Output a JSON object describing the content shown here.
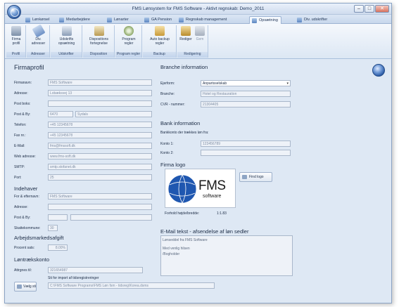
{
  "window": {
    "title": "FMS Lønsystem for FMS Software - Aktivt regnskab: Demo_2011",
    "controls": [
      "–",
      "□",
      "✕"
    ]
  },
  "tabs": [
    {
      "label": "Lønkørsel",
      "active": false
    },
    {
      "label": "Medarbejdere",
      "active": false
    },
    {
      "label": "Lønarter",
      "active": false
    },
    {
      "label": "GA Pension",
      "active": false
    },
    {
      "label": "Regnskab management",
      "active": false
    },
    {
      "label": "Opsætning",
      "active": true
    },
    {
      "label": "Div. udskrifter",
      "active": false
    }
  ],
  "ribbon": {
    "groups": [
      {
        "label": "Profil",
        "buttons": [
          {
            "label1": "Firma",
            "label2": "profil"
          }
        ]
      },
      {
        "label": "Adresser",
        "buttons": [
          {
            "label1": "Div.",
            "label2": "adresser"
          }
        ]
      },
      {
        "label": "Udskrifter",
        "buttons": [
          {
            "label1": "Udskrifts",
            "label2": "opsætning"
          }
        ]
      },
      {
        "label": "Disposition",
        "buttons": [
          {
            "label1": "Dispositions",
            "label2": "fortegnelse"
          }
        ]
      },
      {
        "label": "Program regler",
        "buttons": [
          {
            "label1": "Program",
            "label2": "regler"
          }
        ]
      },
      {
        "label": "Backup",
        "buttons": [
          {
            "label1": "Auto backup",
            "label2": "regler"
          }
        ]
      },
      {
        "label": "Redigering",
        "buttons": [
          {
            "label1": "Rediger",
            "label2": ""
          },
          {
            "label1": "Gem",
            "label2": ""
          }
        ]
      }
    ]
  },
  "firmaprofil": {
    "heading": "Firmaprofil",
    "fields": [
      {
        "label": "Firmanavn:",
        "value": "FMS Software"
      },
      {
        "label": "Adresse:",
        "value": "Lobæksvej 13"
      },
      {
        "label": "Post boks:",
        "value": ""
      },
      {
        "label": "Post & By:",
        "value": "6470",
        "value2": "Sydals"
      },
      {
        "label": "Telefon:",
        "value": "+45 12345678"
      },
      {
        "label": "Fax nr.:",
        "value": "+45 12345678"
      },
      {
        "label": "E-Mail:",
        "value": "fms@fmssoft.dk"
      },
      {
        "label": "Web adresse:",
        "value": "www.fms-soft.dk"
      },
      {
        "label": "SMTP:",
        "value": "smtp.stofanet.dk"
      },
      {
        "label": "Port:",
        "value": "25"
      }
    ]
  },
  "indehaver": {
    "heading": "Indehaver",
    "fields": [
      {
        "label": "For & efternavn:",
        "value": "FMS Software"
      },
      {
        "label": "Adresse:",
        "value": ""
      },
      {
        "label": "Post & By:",
        "value": "",
        "value2": ""
      },
      {
        "label": "Skattekommune:",
        "value": "30"
      }
    ]
  },
  "arbejdsmarked": {
    "heading": "Arbejdsmarkedsafgift",
    "label": "Procent sats:",
    "value": "8.00%"
  },
  "loentraek": {
    "heading": "Løntrækskonto",
    "label": "Attrgnes til:",
    "value": "321654987",
    "import_label": "Sti for import af tidsregistreringer",
    "import_button": "Vælg sti",
    "import_path": "C:\\FMS Software Programs\\FMS Løn fsm - tidsreg\\Korea.dsms"
  },
  "branche": {
    "heading": "Branche information",
    "fields": [
      {
        "label": "Ejerform:",
        "value": "Anpartsselskab",
        "type": "select"
      },
      {
        "label": "Branche:",
        "value": "Hotel og Restauration"
      },
      {
        "label": "CVR - nummer:",
        "value": "21304405"
      }
    ]
  },
  "bank": {
    "heading": "Bank information",
    "subtitle": "Bankkonto der trækkes løn fra:",
    "fields": [
      {
        "label": "Konto 1:",
        "value": "123456789"
      },
      {
        "label": "Konto 2:",
        "value": ""
      }
    ]
  },
  "logo": {
    "heading": "Firma logo",
    "brand": "FMS",
    "brand_sub": "software",
    "find_button": "Find logo",
    "ratio_label": "Forhold højde/bredde:",
    "ratio_value": "1:1.83"
  },
  "email": {
    "heading": "E-Mail tekst - afsendelse af løn sedler",
    "lines": [
      "Lønseddel fra FMS Software",
      "",
      "Med venlig hilsen",
      "/Bogholder"
    ]
  },
  "colors": {
    "accent": "#2c5aa0",
    "background": "#dee8f4"
  }
}
